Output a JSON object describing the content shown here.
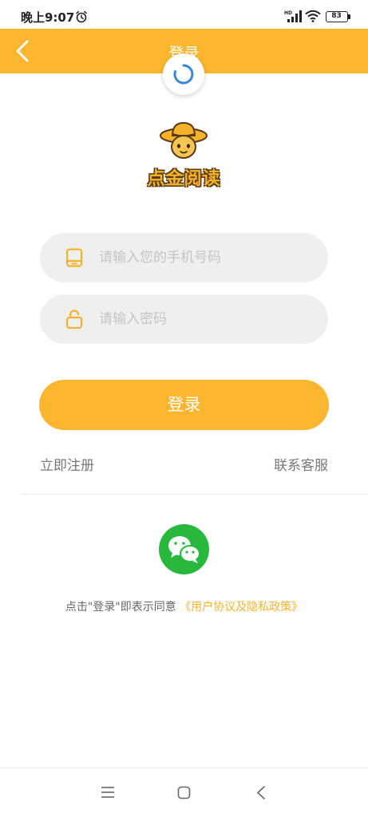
{
  "status_bar": {
    "time": "晚上9:07",
    "battery": "83"
  },
  "header": {
    "title": "登录"
  },
  "logo": {
    "text": "点金阅读"
  },
  "form": {
    "phone_placeholder": "请输入您的手机号码",
    "phone_value": "",
    "password_placeholder": "请输入密码",
    "password_value": ""
  },
  "login_button_label": "登录",
  "links": {
    "register": "立即注册",
    "contact": "联系客服"
  },
  "agreement": {
    "prefix": "点击\"登录\"即表示同意",
    "link": "《用户协议及隐私政策》"
  },
  "colors": {
    "accent": "#fbb52e",
    "wechat": "#27b83c",
    "input_bg": "#efefef",
    "link": "#f5b32c"
  },
  "icons": {
    "back": "chevron-left-icon",
    "phone": "phone-icon",
    "lock": "lock-icon",
    "wechat": "wechat-icon",
    "loading": "loading-spinner-icon"
  }
}
